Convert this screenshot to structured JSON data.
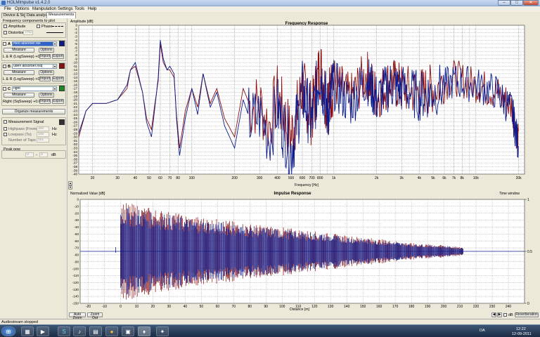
{
  "app": {
    "title": "HOLMImpulse v1.4.2.0"
  },
  "menu": [
    "File",
    "Options",
    "Manipulation",
    "Settings",
    "Tools",
    "Help"
  ],
  "tabs": [
    "Device & Signal",
    "Data analysis",
    "Measurements"
  ],
  "left": {
    "frequency_components_label": "Frequency components to plot",
    "amplitude_label": "Amplitude",
    "phase_label": "Phase",
    "distortion_label": "Distortion",
    "distortion_value": "THD",
    "measurements": [
      {
        "letter": "A",
        "name": "med absorber.fax",
        "color": "#0b1b8f",
        "measure": "Measure",
        "options": "Options",
        "info": "L & R (LogSweep) +0.0dB",
        "import": "Import",
        "export": "Export"
      },
      {
        "letter": "B",
        "name": "uden absorber.hsq",
        "color": "#8e0e0e",
        "measure": "Measure",
        "options": "Options",
        "info": "L & R (LogSweep) +0.0dB",
        "import": "Import",
        "export": "Export"
      },
      {
        "letter": "C",
        "name": "right",
        "color": "#1c8a1c",
        "measure": "Measure",
        "options": "Options",
        "info": "Right (SqSweep) +0.0dB",
        "import": "Import",
        "export": "Export"
      }
    ],
    "organize": "Organize measurements",
    "measurement_signal": "Measurement Signal",
    "highpass": "Highpass (Fnom)",
    "highpass_val": "300",
    "lowpass": "Lowpass (To)",
    "lowpass_val": "500",
    "taps": "Number of Taps",
    "taps_val": "501",
    "hz": "Hz",
    "peak_label": "Peak pow",
    "peak_from": "0",
    "peak_to": "0",
    "peak_unit": "dB"
  },
  "freq_chart": {
    "title": "Frequency Response",
    "ylabel": "Amplitude [dB]",
    "xlabel": "Frequency [Hz]",
    "yticks": [
      "0",
      "-1",
      "-2",
      "-3",
      "-4",
      "-5",
      "-6",
      "-7",
      "-8",
      "-9",
      "-10",
      "-11",
      "-12",
      "-13",
      "-14",
      "-15",
      "-16",
      "-17",
      "-18",
      "-19",
      "-20",
      "-21",
      "-22",
      "-23",
      "-24",
      "-25",
      "-26",
      "-27",
      "-28",
      "-29",
      "-30",
      "-31",
      "-32",
      "-33",
      "-34",
      "-35",
      "-36",
      "-37",
      "-38",
      "-39",
      "-40"
    ],
    "xticks": [
      "20",
      "30",
      "40",
      "50",
      "60",
      "70",
      "80",
      "100",
      "200",
      "300",
      "400",
      "500",
      "600",
      "700",
      "800",
      "1k",
      "2k",
      "3k",
      "4k",
      "5k",
      "6k",
      "7k",
      "8k",
      "10k",
      "20k"
    ]
  },
  "imp_chart": {
    "title": "Impulse Response",
    "ylabel": "Normalized Value [dB]",
    "xlabel": "Distance [m]",
    "tw_label": "Time window",
    "yticks": [
      "0",
      "-10",
      "-20",
      "-30",
      "-40",
      "-50",
      "-60",
      "-70",
      "-80",
      "-90",
      "-100",
      "-110",
      "-120",
      "-130",
      "-140",
      "-150"
    ],
    "xticks": [
      "-20",
      "-10",
      "0",
      "10",
      "20",
      "30",
      "40",
      "50",
      "60",
      "70",
      "80",
      "90",
      "100",
      "110",
      "120",
      "130",
      "140",
      "150",
      "160",
      "170",
      "180",
      "190",
      "200",
      "210",
      "220",
      "230",
      "240"
    ],
    "tw_ticks": [
      "1",
      "0.5",
      "0"
    ],
    "auto_zoom": "Auto Zoom",
    "zoom_out": "Zoom Out",
    "db_label": "dB",
    "reverberation": "Reverberation"
  },
  "chart_data": [
    {
      "type": "line",
      "title": "Frequency Response",
      "xlabel": "Frequency [Hz]",
      "ylabel": "Amplitude [dB]",
      "xscale": "log",
      "xlim": [
        16,
        22000
      ],
      "ylim": [
        -40,
        0
      ],
      "x": [
        16,
        18,
        20,
        25,
        30,
        35,
        37,
        40,
        45,
        48,
        52,
        55,
        58,
        60,
        63,
        67,
        70,
        75,
        78,
        82,
        90,
        100,
        110,
        120,
        135,
        150,
        170,
        200,
        230,
        260,
        300,
        350,
        400,
        500,
        600,
        700,
        800,
        900,
        1000,
        1300,
        1700,
        2000,
        2500,
        3000,
        4000,
        5000,
        7000,
        10000,
        14000,
        18000,
        20000
      ],
      "series": [
        {
          "name": "med absorber.fax",
          "values": [
            -29,
            -23,
            -21,
            -21,
            -20,
            -16,
            -12,
            -10,
            -18,
            -26,
            -30,
            -22,
            -14,
            -4,
            -9,
            -12,
            -11,
            -13,
            -25,
            -35,
            -25,
            -17,
            -24,
            -13,
            -22,
            -18,
            -27,
            -33,
            -20,
            -26,
            -24,
            -30,
            -22,
            -34,
            -18,
            -26,
            -12,
            -23,
            -16,
            -21,
            -14,
            -20,
            -16,
            -17,
            -19,
            -18,
            -15,
            -16,
            -18,
            -23,
            -33
          ]
        },
        {
          "name": "uden absorber.hsq",
          "values": [
            -30,
            -23,
            -21,
            -21,
            -20,
            -17,
            -12,
            -11,
            -18,
            -25,
            -28,
            -21,
            -15,
            -5,
            -10,
            -12,
            -12,
            -14,
            -24,
            -33,
            -23,
            -17,
            -22,
            -13,
            -21,
            -17,
            -25,
            -30,
            -17,
            -22,
            -21,
            -27,
            -19,
            -30,
            -17,
            -24,
            -11,
            -21,
            -15,
            -20,
            -13,
            -19,
            -15,
            -17,
            -18,
            -17,
            -14,
            -16,
            -18,
            -22,
            -32
          ]
        }
      ]
    },
    {
      "type": "line",
      "title": "Impulse Response",
      "xlabel": "Distance [m]",
      "ylabel": "Normalized Value [dB]",
      "xlim": [
        -25,
        250
      ],
      "ylim": [
        -150,
        0
      ],
      "x": [
        0,
        20,
        40,
        60,
        80,
        100,
        120,
        140,
        160,
        180,
        200,
        210
      ],
      "series": [
        {
          "name": "envelope",
          "values": [
            -3,
            -12,
            -22,
            -28,
            -35,
            -40,
            -46,
            -52,
            -57,
            -63,
            -66,
            -69
          ]
        }
      ]
    }
  ]
}
